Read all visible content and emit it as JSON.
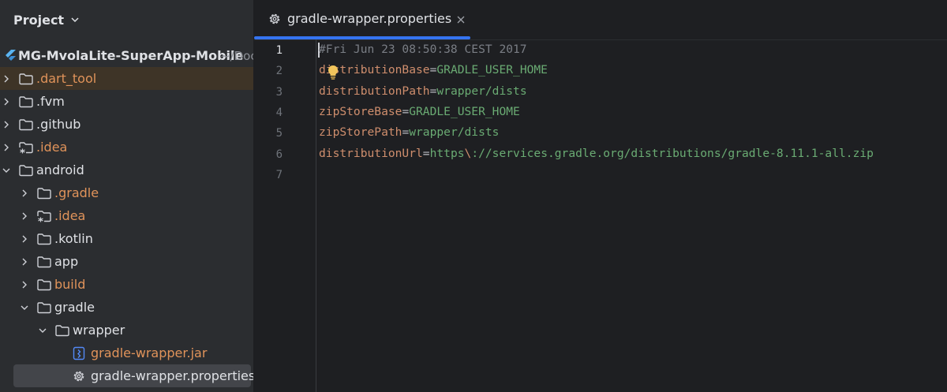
{
  "project_panel": {
    "title": "Project",
    "root": {
      "name": "MG-MvolaLite-SuperApp-Mobile",
      "path": "~/Doc"
    },
    "tree": [
      {
        "label": ".dart_tool",
        "depth": 0,
        "expanded": false,
        "icon": "folder-icon",
        "color": "orange",
        "highlight": true
      },
      {
        "label": ".fvm",
        "depth": 0,
        "expanded": false,
        "icon": "folder-icon",
        "color": "white"
      },
      {
        "label": ".github",
        "depth": 0,
        "expanded": false,
        "icon": "folder-icon",
        "color": "white"
      },
      {
        "label": ".idea",
        "depth": 0,
        "expanded": false,
        "icon": "idea-folder-icon",
        "color": "orange"
      },
      {
        "label": "android",
        "depth": 0,
        "expanded": true,
        "icon": "folder-icon",
        "color": "white"
      },
      {
        "label": ".gradle",
        "depth": 1,
        "expanded": false,
        "icon": "folder-icon",
        "color": "orange"
      },
      {
        "label": ".idea",
        "depth": 1,
        "expanded": false,
        "icon": "idea-folder-icon",
        "color": "orange"
      },
      {
        "label": ".kotlin",
        "depth": 1,
        "expanded": false,
        "icon": "folder-icon",
        "color": "white"
      },
      {
        "label": "app",
        "depth": 1,
        "expanded": false,
        "icon": "folder-icon",
        "color": "white"
      },
      {
        "label": "build",
        "depth": 1,
        "expanded": false,
        "icon": "folder-icon",
        "color": "orange"
      },
      {
        "label": "gradle",
        "depth": 1,
        "expanded": true,
        "icon": "folder-icon",
        "color": "white"
      },
      {
        "label": "wrapper",
        "depth": 2,
        "expanded": true,
        "icon": "folder-icon",
        "color": "white"
      },
      {
        "label": "gradle-wrapper.jar",
        "depth": 3,
        "leaf": true,
        "icon": "jar-file-icon",
        "color": "orange"
      },
      {
        "label": "gradle-wrapper.properties",
        "depth": 3,
        "leaf": true,
        "icon": "gear-icon",
        "color": "white",
        "selected": true
      }
    ]
  },
  "editor": {
    "tab": {
      "label": "gradle-wrapper.properties"
    },
    "line_numbers": [
      "1",
      "2",
      "3",
      "4",
      "5",
      "6",
      "7"
    ],
    "current_line": 1,
    "lines": [
      {
        "comment": "#Fri Jun 23 08:50:38 CEST 2017"
      },
      {
        "key": "distributionBase",
        "eq": "=",
        "value": "GRADLE_USER_HOME"
      },
      {
        "key": "distributionPath",
        "eq": "=",
        "value": "wrapper/dists"
      },
      {
        "key": "zipStoreBase",
        "eq": "=",
        "value": "GRADLE_USER_HOME"
      },
      {
        "key": "zipStorePath",
        "eq": "=",
        "value": "wrapper/dists"
      },
      {
        "key": "distributionUrl",
        "eq": "=",
        "value": "https",
        "escape": "\\",
        "value2": "://services.gradle.org/distributions/gradle-8.11.1-all.zip"
      },
      {}
    ]
  },
  "colors": {
    "accent": "#3574f0",
    "panel_bg": "#2b2d30",
    "editor_bg": "#1e1f22",
    "orange_text": "#e0935a",
    "key": "#cf8e6d",
    "value": "#6aab73",
    "comment": "#7a7e85"
  }
}
